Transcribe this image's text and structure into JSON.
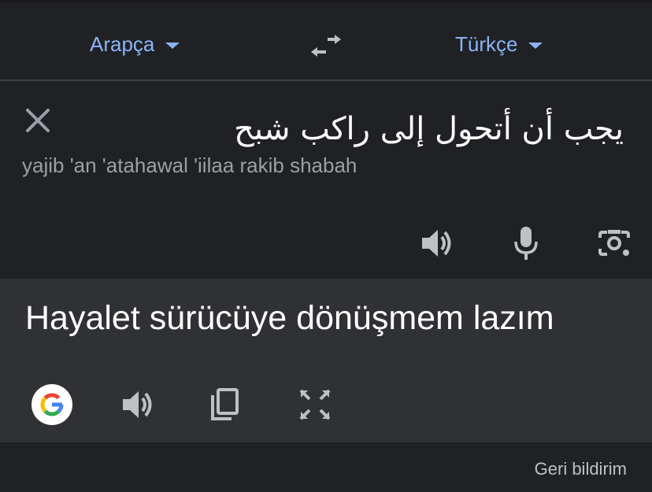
{
  "languages": {
    "source": "Arapça",
    "target": "Türkçe"
  },
  "input": {
    "text": "يجب أن أتحول إلى راكب شبح",
    "transliteration": "yajib 'an 'atahawal 'iilaa rakib shabah"
  },
  "output": {
    "translation": "Hayalet sürücüye dönüşmem lazım"
  },
  "footer": {
    "feedback": "Geri bildirim"
  },
  "icons": {
    "swap": "swap-arrows-icon",
    "close": "close-icon",
    "speaker": "speaker-icon",
    "mic": "microphone-icon",
    "camera": "camera-icon",
    "google": "google-logo",
    "copy": "copy-icon",
    "expand": "fullscreen-icon"
  },
  "colors": {
    "accent": "#8ab4f8",
    "background": "#202124",
    "output_background": "#303134",
    "icon": "#bdc1c6"
  }
}
